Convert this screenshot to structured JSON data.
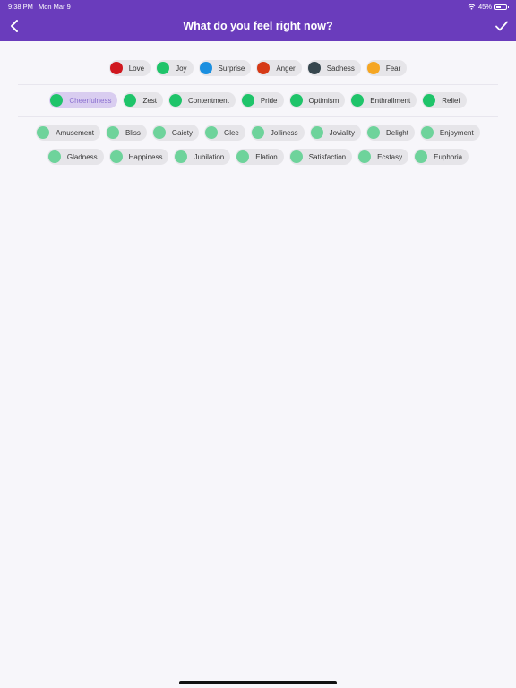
{
  "status": {
    "time": "9:38 PM",
    "date": "Mon Mar 9",
    "battery": "45%"
  },
  "header": {
    "title": "What do you feel right now?"
  },
  "colors": {
    "header_bg": "#6a3cbc",
    "joy_green": "#1fc46a",
    "joy_green_light": "#6ed39b",
    "selected_text": "#8a6fd0"
  },
  "emotions": [
    {
      "label": "Love",
      "color": "#d0181f"
    },
    {
      "label": "Joy",
      "color": "#1fc46a"
    },
    {
      "label": "Surprise",
      "color": "#1b8fe0"
    },
    {
      "label": "Anger",
      "color": "#d63a17"
    },
    {
      "label": "Sadness",
      "color": "#37474f"
    },
    {
      "label": "Fear",
      "color": "#f5a623"
    }
  ],
  "sub_emotions": [
    {
      "label": "Cheerfulness",
      "selected": true
    },
    {
      "label": "Zest"
    },
    {
      "label": "Contentment"
    },
    {
      "label": "Pride"
    },
    {
      "label": "Optimism"
    },
    {
      "label": "Enthrallment"
    },
    {
      "label": "Relief"
    }
  ],
  "detail_row1": [
    "Amusement",
    "Bliss",
    "Gaiety",
    "Glee",
    "Jolliness",
    "Joviality",
    "Delight",
    "Enjoyment"
  ],
  "detail_row2": [
    "Gladness",
    "Happiness",
    "Jubilation",
    "Elation",
    "Satisfaction",
    "Ecstasy",
    "Euphoria"
  ]
}
